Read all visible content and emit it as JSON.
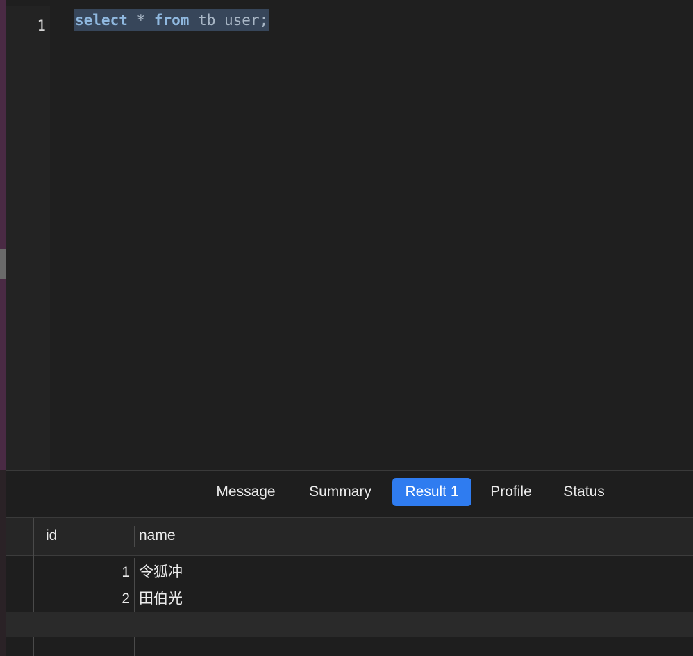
{
  "editor": {
    "line_number": "1",
    "code": {
      "kw_select": "select",
      "star": "*",
      "kw_from": "from",
      "table": "tb_user;"
    }
  },
  "tabs": [
    {
      "label": "Message",
      "active": false
    },
    {
      "label": "Summary",
      "active": false
    },
    {
      "label": "Result 1",
      "active": true
    },
    {
      "label": "Profile",
      "active": false
    },
    {
      "label": "Status",
      "active": false
    }
  ],
  "result": {
    "columns": [
      "id",
      "name"
    ],
    "rows": [
      {
        "id": "1",
        "name": "令狐冲"
      },
      {
        "id": "2",
        "name": "田伯光"
      }
    ]
  },
  "colors": {
    "accent": "#2f7cf0",
    "selection": "#37465a",
    "background": "#1e1e1e"
  }
}
